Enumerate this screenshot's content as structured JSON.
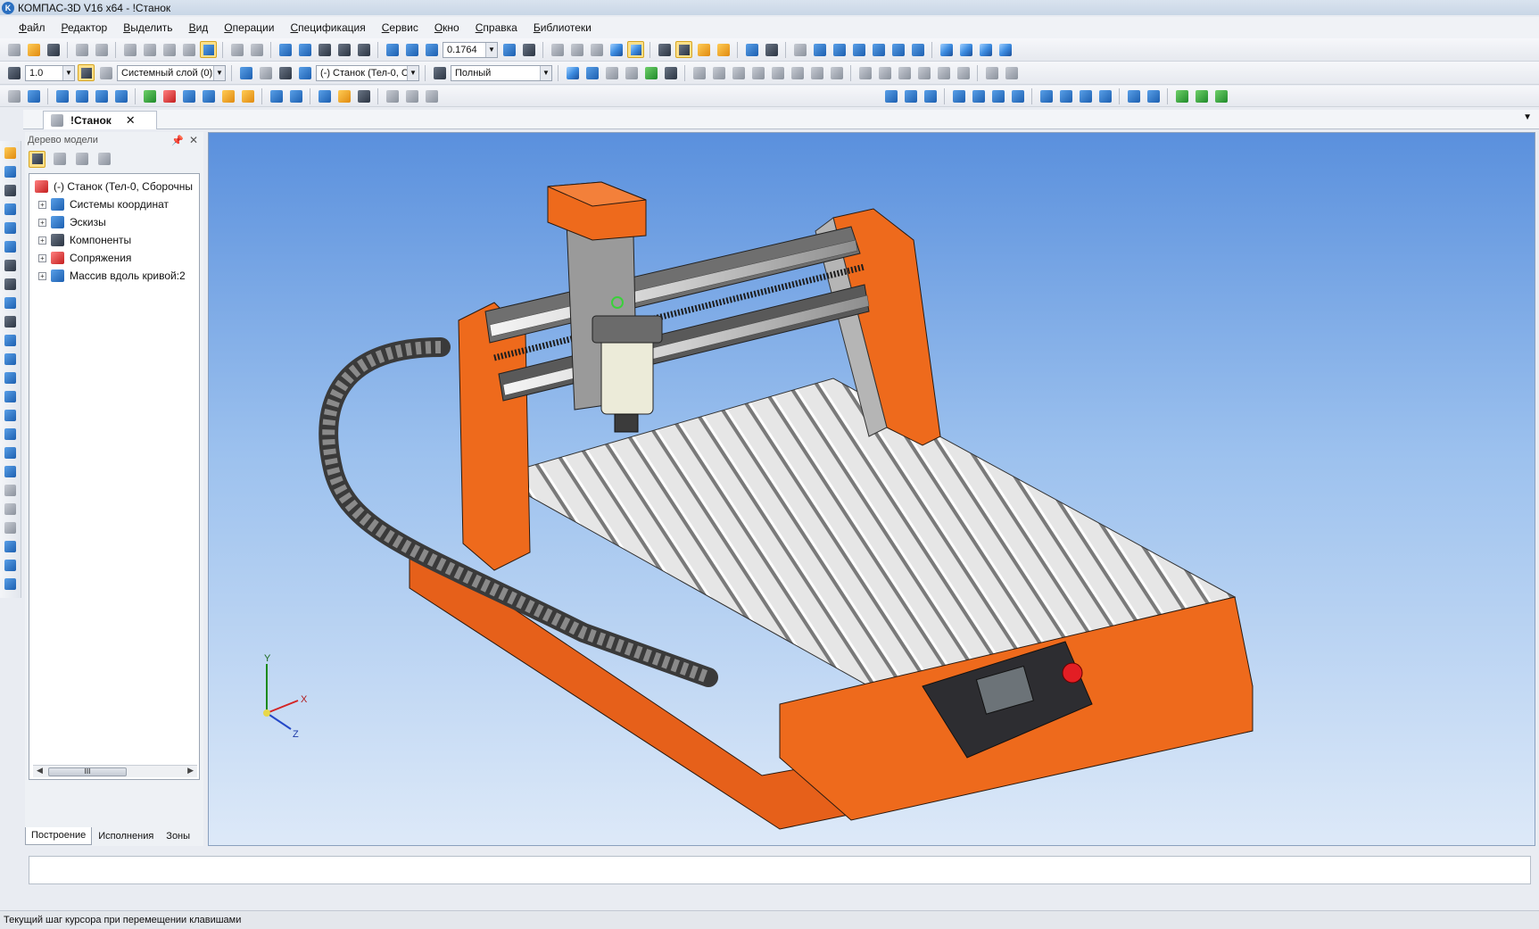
{
  "window": {
    "title": "КОМПАС-3D V16  x64 - !Станок"
  },
  "menu": [
    "Файл",
    "Редактор",
    "Выделить",
    "Вид",
    "Операции",
    "Спецификация",
    "Сервис",
    "Окно",
    "Справка",
    "Библиотеки"
  ],
  "toolbar": {
    "zoom_value": "0.1764",
    "step_value": "1.0",
    "layer_value": "Системный слой (0)",
    "component_value": "(-) Станок (Тел-0, С",
    "display_mode": "Полный"
  },
  "document_tab": {
    "label": "!Станок",
    "close": "✕"
  },
  "model_tree": {
    "title": "Дерево модели",
    "root": "(-) Станок (Тел-0, Сборочны",
    "items": [
      {
        "label": "Системы координат",
        "icon": "coordinate-systems-icon"
      },
      {
        "label": "Эскизы",
        "icon": "sketches-icon"
      },
      {
        "label": "Компоненты",
        "icon": "components-icon"
      },
      {
        "label": "Сопряжения",
        "icon": "mates-icon"
      },
      {
        "label": "Массив вдоль кривой:2",
        "icon": "curve-pattern-icon"
      }
    ],
    "tabs": [
      "Построение",
      "Исполнения",
      "Зоны"
    ],
    "scroll_label": "III"
  },
  "axes_triad": {
    "x": "X",
    "y": "Y",
    "z": "Z"
  },
  "status": {
    "text": "Текущий шаг курсора при перемещении клавишами"
  },
  "colors": {
    "machine_orange": "#ee6a1c",
    "viewport_top": "#5a90dd",
    "viewport_bottom": "#dde9f8"
  }
}
